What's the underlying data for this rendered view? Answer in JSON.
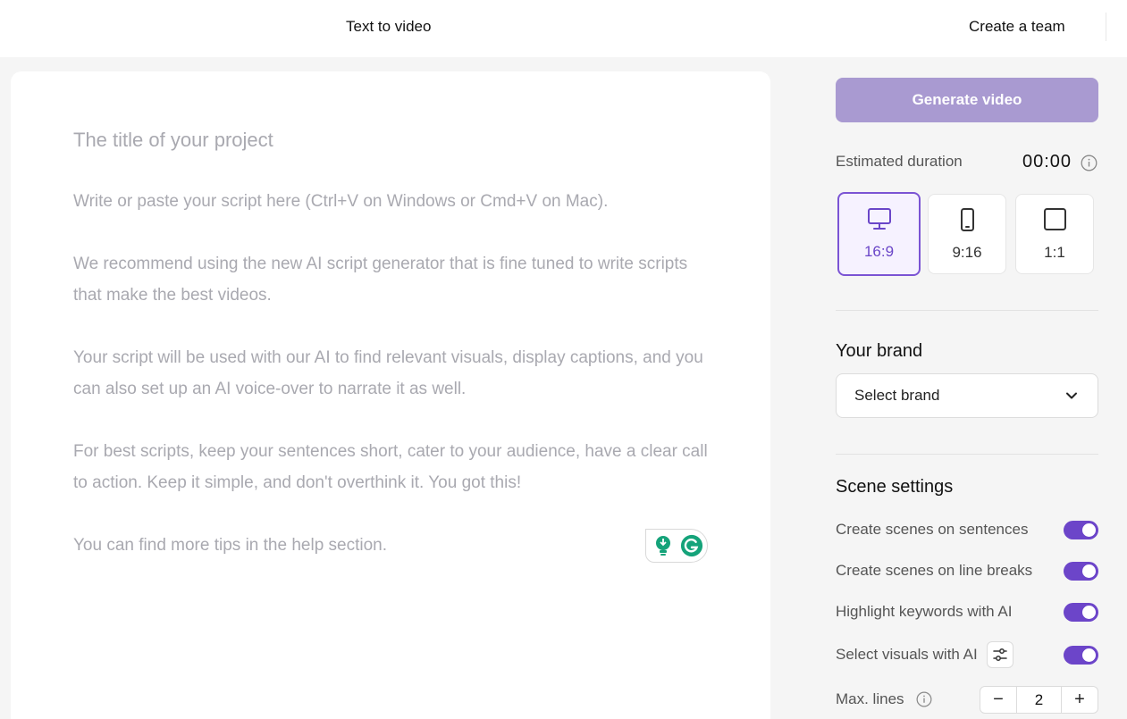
{
  "header": {
    "page_title": "Text to video",
    "team_link": "Create a team"
  },
  "editor": {
    "title_placeholder": "The title of your project",
    "script_placeholder": [
      "Write or paste your script here (Ctrl+V on Windows or Cmd+V on Mac).",
      "We recommend using the new AI script generator that is fine tuned to write scripts that make the best videos.",
      "Your script will be used with our AI to find relevant visuals, display captions, and you can also set up an AI voice-over to narrate it as well.",
      "For best scripts, keep your sentences short, cater to your audience, have a clear call to action. Keep it simple, and don't overthink it. You got this!",
      "You can find more tips in the help section."
    ]
  },
  "sidebar": {
    "generate_label": "Generate video",
    "duration_label": "Estimated duration",
    "duration_value": "00:00",
    "ratios": [
      {
        "label": "16:9",
        "icon": "monitor-icon",
        "selected": true
      },
      {
        "label": "9:16",
        "icon": "phone-icon",
        "selected": false
      },
      {
        "label": "1:1",
        "icon": "square-icon",
        "selected": false
      }
    ],
    "brand_title": "Your brand",
    "brand_select_value": "Select brand",
    "scene_title": "Scene settings",
    "settings": [
      {
        "label": "Create scenes on sentences",
        "on": true
      },
      {
        "label": "Create scenes on line breaks",
        "on": true
      },
      {
        "label": "Highlight keywords with AI",
        "on": true
      },
      {
        "label": "Select visuals with AI",
        "on": true
      }
    ],
    "max_lines_label": "Max. lines",
    "max_lines_value": "2",
    "stepper_minus": "−",
    "stepper_plus": "+"
  },
  "colors": {
    "accent": "#6c45c9",
    "generate_disabled": "#a99ad1",
    "grammarly_green": "#15a37a"
  }
}
